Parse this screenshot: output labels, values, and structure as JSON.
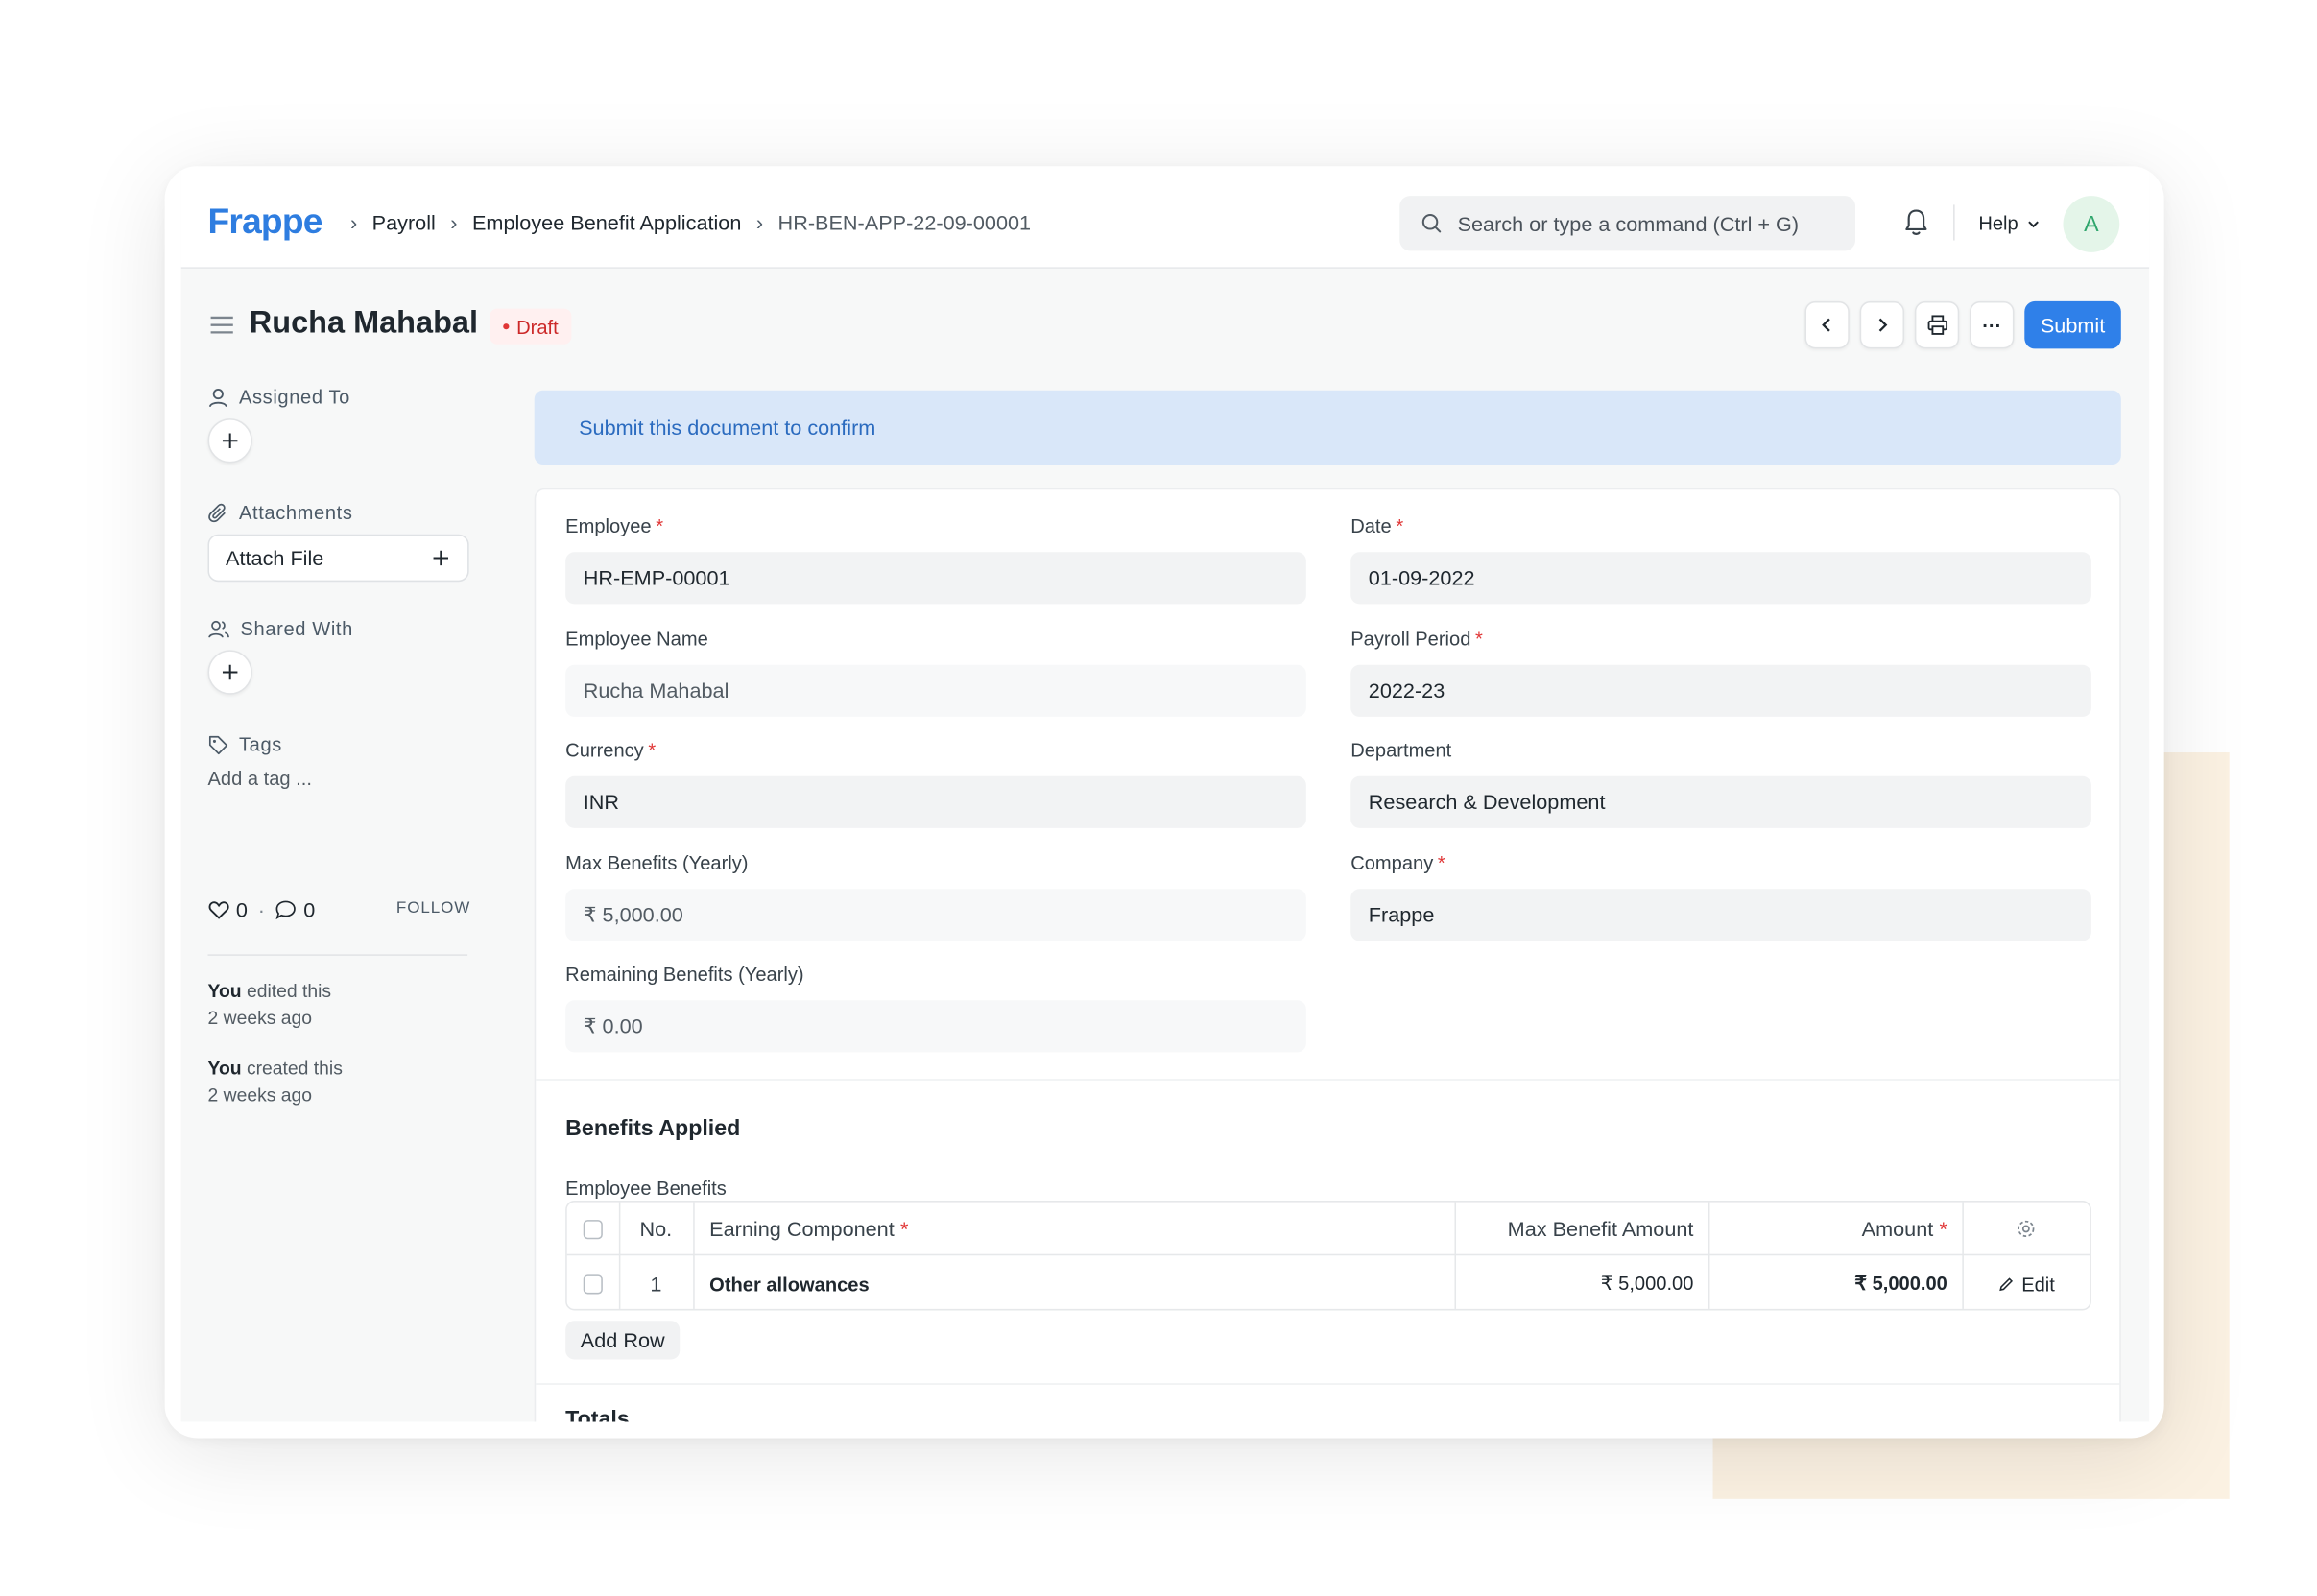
{
  "navbar": {
    "logo": "Frappe",
    "breadcrumbs": [
      "Payroll",
      "Employee Benefit Application",
      "HR-BEN-APP-22-09-00001"
    ],
    "search_placeholder": "Search or type a command (Ctrl + G)",
    "help_label": "Help",
    "avatar_initial": "A"
  },
  "page": {
    "title": "Rucha Mahabal",
    "status": "Draft",
    "submit_label": "Submit",
    "more_label": "···"
  },
  "sidebar": {
    "assigned_to": "Assigned To",
    "attachments": "Attachments",
    "attach_file": "Attach File",
    "shared_with": "Shared With",
    "tags": "Tags",
    "add_tag": "Add a tag ...",
    "likes": "0",
    "comments": "0",
    "follow": "FOLLOW",
    "activity": [
      {
        "who": "You",
        "what": " edited this",
        "when": "2 weeks ago"
      },
      {
        "who": "You",
        "what": " created this",
        "when": "2 weeks ago"
      }
    ]
  },
  "intro": "Submit this document to confirm",
  "form": {
    "employee": {
      "label": "Employee",
      "value": "HR-EMP-00001"
    },
    "date": {
      "label": "Date",
      "value": "01-09-2022"
    },
    "employee_name": {
      "label": "Employee Name",
      "value": "Rucha Mahabal"
    },
    "payroll_period": {
      "label": "Payroll Period",
      "value": "2022-23"
    },
    "currency": {
      "label": "Currency",
      "value": "INR"
    },
    "department": {
      "label": "Department",
      "value": "Research & Development"
    },
    "max_benefits": {
      "label": "Max Benefits (Yearly)",
      "value": "₹ 5,000.00"
    },
    "company": {
      "label": "Company",
      "value": "Frappe"
    },
    "remaining_benefits": {
      "label": "Remaining Benefits (Yearly)",
      "value": "₹ 0.00"
    }
  },
  "benefits": {
    "section_title": "Benefits Applied",
    "table_label": "Employee Benefits",
    "headers": {
      "no": "No.",
      "component": "Earning Component",
      "max": "Max Benefit Amount",
      "amount": "Amount"
    },
    "rows": [
      {
        "no": "1",
        "component": "Other allowances",
        "max": "₹ 5,000.00",
        "amount": "₹ 5,000.00",
        "edit": "Edit"
      }
    ],
    "add_row": "Add Row"
  },
  "totals_title": "Totals",
  "colors": {
    "brand": "#2e7de0",
    "primary": "#2f80e9",
    "draft": "#cc2929",
    "required": "#e03636"
  }
}
